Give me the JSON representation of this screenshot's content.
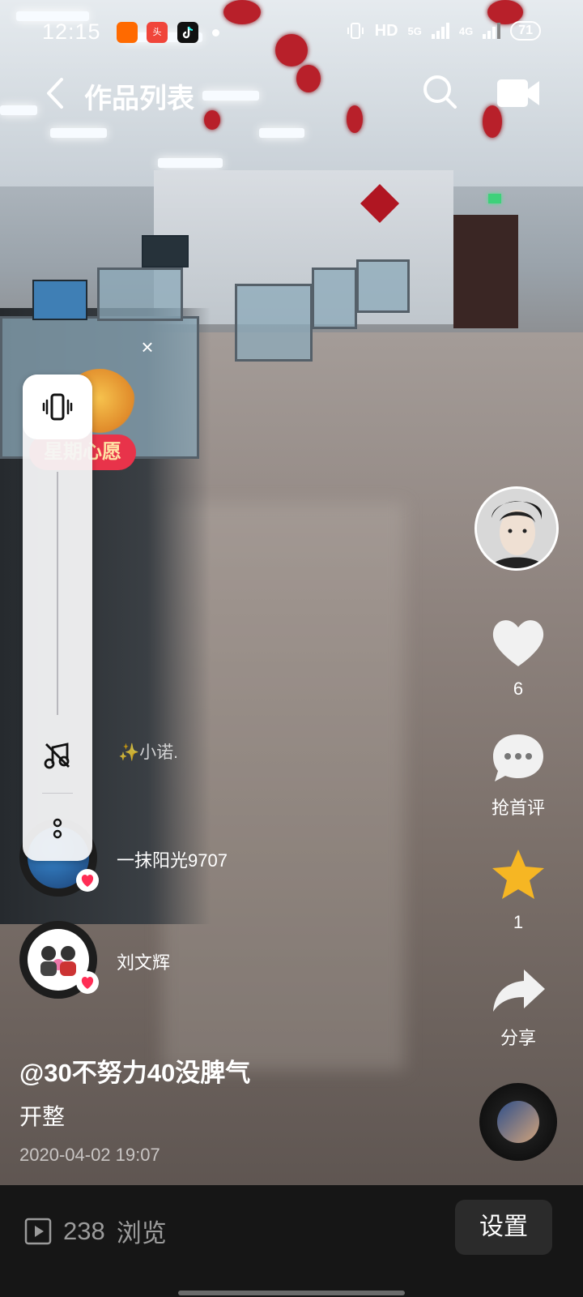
{
  "status_bar": {
    "time": "12:15",
    "signal_labels": [
      "HD",
      "5G",
      "4G"
    ],
    "battery": "71"
  },
  "header": {
    "title": "作品列表"
  },
  "promo": {
    "badge_text": "星期心愿"
  },
  "fans": [
    {
      "name": "✨小诺."
    },
    {
      "name": "一抹阳光9707"
    },
    {
      "name": "刘文辉"
    }
  ],
  "actions": {
    "like_count": "6",
    "comment_label": "抢首评",
    "favorite_count": "1",
    "share_label": "分享"
  },
  "caption": {
    "user": "@30不努力40没脾气",
    "text": "开整",
    "date": "2020-04-02 19:07"
  },
  "bottom_bar": {
    "view_count": "238",
    "view_label": "浏览",
    "settings_label": "设置"
  },
  "colors": {
    "like": "#ffffff",
    "favorite": "#f6b623",
    "heart_badge": "#ff2d55",
    "promo": "#e8334a"
  }
}
